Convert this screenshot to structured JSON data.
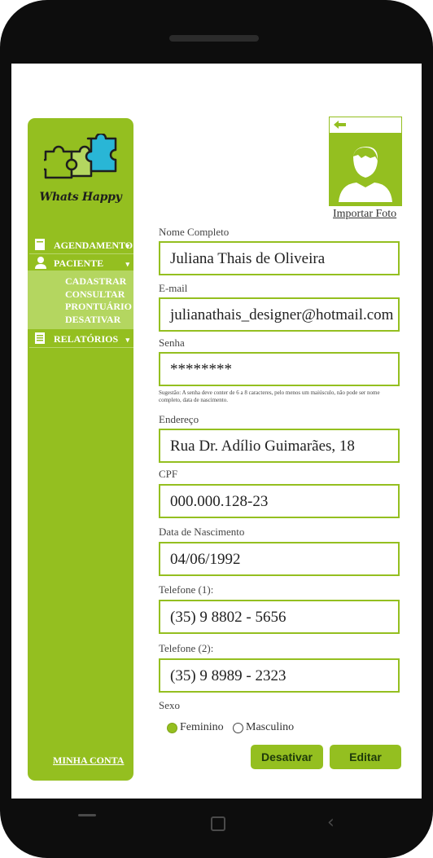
{
  "brand": {
    "name": "Whats Happy"
  },
  "sidebar": {
    "items": [
      {
        "label": "AGENDAMENTO",
        "icon": "calendar-icon"
      },
      {
        "label": "PACIENTE",
        "icon": "user-icon"
      },
      {
        "label": "RELATÓRIOS",
        "icon": "report-icon"
      }
    ],
    "submenu": [
      "CADASTRAR",
      "CONSULTAR",
      "PRONTUÁRIO",
      "DESATIVAR"
    ],
    "account": "MINHA CONTA"
  },
  "photo": {
    "import_label": "Importar Foto"
  },
  "form": {
    "name_label": "Nome Completo",
    "name_value": "Juliana Thais de Oliveira",
    "email_label": "E-mail",
    "email_value": "julianathais_designer@hotmail.com",
    "password_label": "Senha",
    "password_value": "********",
    "password_hint": "Sugestão: A senha deve conter de 6 a 8 caracteres, pelo menos um maiúsculo, não pode ser nome completo, data de nascimento.",
    "address_label": "Endereço",
    "address_value": "Rua Dr. Adílio Guimarães, 18",
    "cpf_label": "CPF",
    "cpf_value": "000.000.128-23",
    "birth_label": "Data de Nascimento",
    "birth_value": "04/06/1992",
    "phone1_label": "Telefone (1):",
    "phone1_value": "(35) 9 8802 - 5656",
    "phone2_label": "Telefone (2):",
    "phone2_value": "(35) 9 8989 - 2323",
    "sex_label": "Sexo",
    "sex_options": [
      "Feminino",
      "Masculino"
    ],
    "sex_selected": "Feminino"
  },
  "actions": {
    "deactivate": "Desativar",
    "edit": "Editar"
  },
  "colors": {
    "accent": "#94bf20",
    "accent_light": "#b4d660",
    "puzzle_blue": "#29b6d6"
  }
}
